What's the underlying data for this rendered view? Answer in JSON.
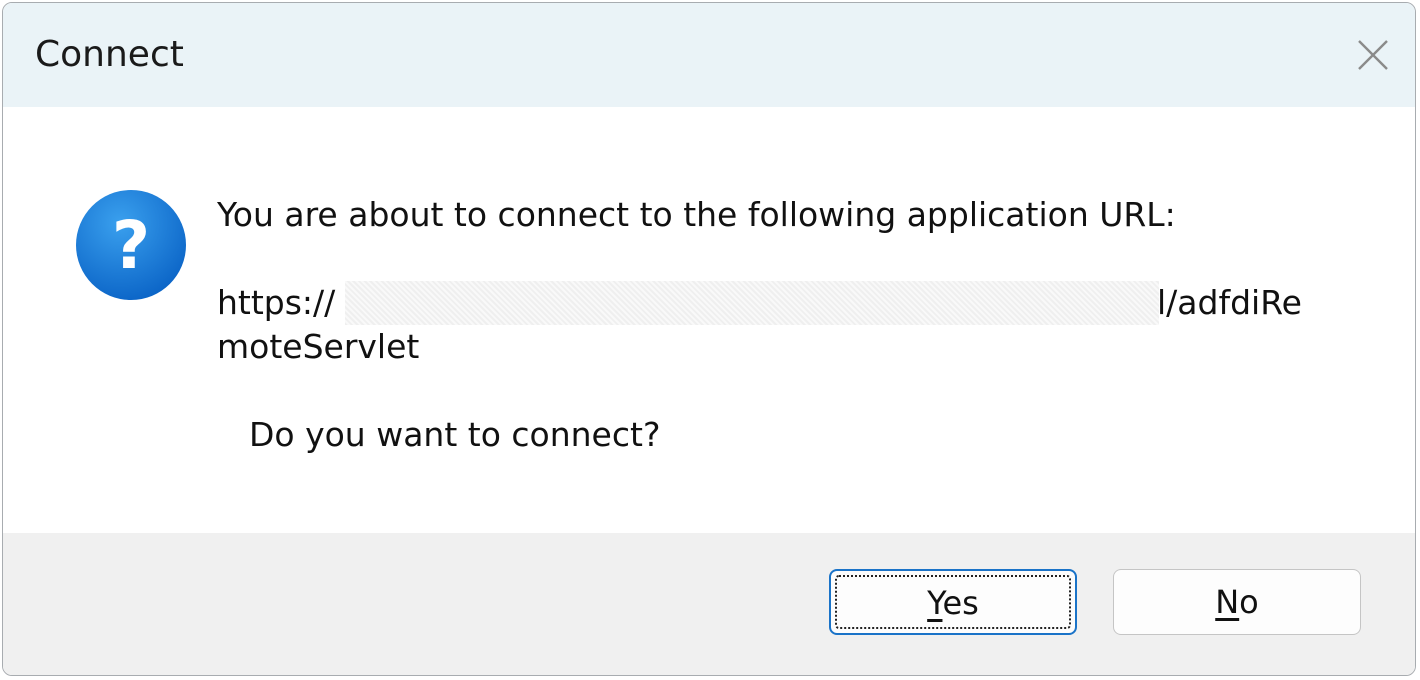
{
  "dialog": {
    "title": "Connect",
    "close_icon": "close-icon",
    "message": "You are about to connect to the following application URL:",
    "url_prefix": "https://",
    "url_suffix": "l/adfdiRe",
    "url_line2": "moteServlet",
    "question": "Do you want to connect?",
    "icon": "question-icon",
    "accent_color": "#1a73c8"
  },
  "buttons": {
    "yes_accel": "Y",
    "yes_rest": "es",
    "no_accel": "N",
    "no_rest": "o"
  }
}
